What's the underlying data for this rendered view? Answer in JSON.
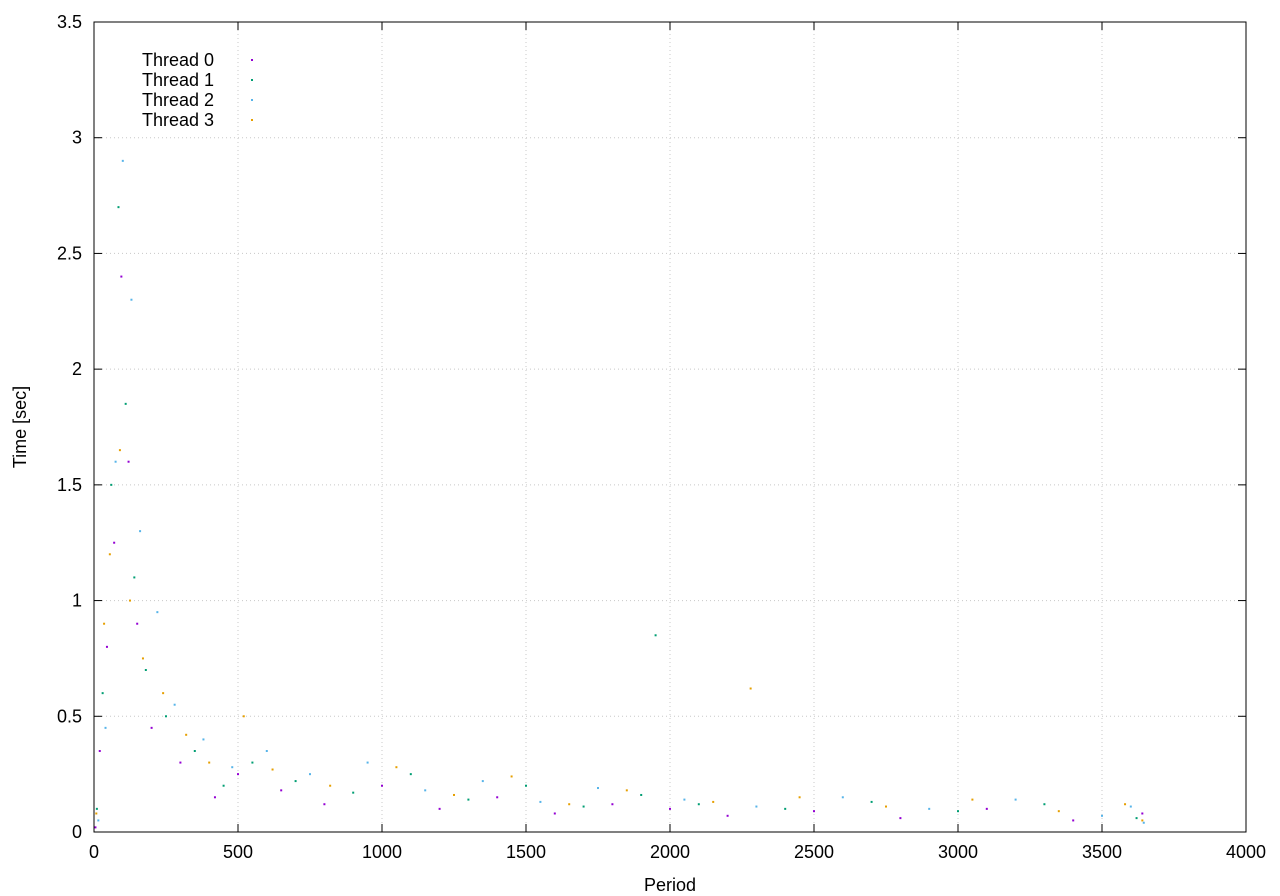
{
  "chart_data": {
    "type": "scatter",
    "title": "",
    "xlabel": "Period",
    "ylabel": "Time [sec]",
    "xlim": [
      0,
      4000
    ],
    "ylim": [
      0,
      3.5
    ],
    "x_ticks": [
      0,
      500,
      1000,
      1500,
      2000,
      2500,
      3000,
      3500,
      4000
    ],
    "y_ticks": [
      0,
      0.5,
      1,
      1.5,
      2,
      2.5,
      3,
      3.5
    ],
    "grid": true,
    "legend_position": "top-left",
    "series": [
      {
        "name": "Thread 0",
        "color": "#9400d3",
        "points": [
          [
            5,
            0.02
          ],
          [
            20,
            0.35
          ],
          [
            45,
            0.8
          ],
          [
            70,
            1.25
          ],
          [
            95,
            2.4
          ],
          [
            120,
            1.6
          ],
          [
            150,
            0.9
          ],
          [
            200,
            0.45
          ],
          [
            300,
            0.3
          ],
          [
            420,
            0.15
          ],
          [
            500,
            0.25
          ],
          [
            650,
            0.18
          ],
          [
            800,
            0.12
          ],
          [
            1000,
            0.2
          ],
          [
            1200,
            0.1
          ],
          [
            1400,
            0.15
          ],
          [
            1600,
            0.08
          ],
          [
            1800,
            0.12
          ],
          [
            2000,
            0.1
          ],
          [
            2200,
            0.07
          ],
          [
            2500,
            0.09
          ],
          [
            2800,
            0.06
          ],
          [
            3100,
            0.1
          ],
          [
            3400,
            0.05
          ],
          [
            3640,
            0.08
          ]
        ]
      },
      {
        "name": "Thread 1",
        "color": "#009e73",
        "points": [
          [
            10,
            0.1
          ],
          [
            30,
            0.6
          ],
          [
            60,
            1.5
          ],
          [
            85,
            2.7
          ],
          [
            110,
            1.85
          ],
          [
            140,
            1.1
          ],
          [
            180,
            0.7
          ],
          [
            250,
            0.5
          ],
          [
            350,
            0.35
          ],
          [
            450,
            0.2
          ],
          [
            550,
            0.3
          ],
          [
            700,
            0.22
          ],
          [
            900,
            0.17
          ],
          [
            1100,
            0.25
          ],
          [
            1300,
            0.14
          ],
          [
            1500,
            0.2
          ],
          [
            1700,
            0.11
          ],
          [
            1900,
            0.16
          ],
          [
            1950,
            0.85
          ],
          [
            2100,
            0.12
          ],
          [
            2400,
            0.1
          ],
          [
            2700,
            0.13
          ],
          [
            3000,
            0.09
          ],
          [
            3300,
            0.12
          ],
          [
            3620,
            0.06
          ]
        ]
      },
      {
        "name": "Thread 2",
        "color": "#56b4e9",
        "points": [
          [
            15,
            0.05
          ],
          [
            40,
            0.45
          ],
          [
            75,
            1.6
          ],
          [
            100,
            2.9
          ],
          [
            130,
            2.3
          ],
          [
            160,
            1.3
          ],
          [
            220,
            0.95
          ],
          [
            280,
            0.55
          ],
          [
            380,
            0.4
          ],
          [
            480,
            0.28
          ],
          [
            600,
            0.35
          ],
          [
            750,
            0.25
          ],
          [
            950,
            0.3
          ],
          [
            1150,
            0.18
          ],
          [
            1350,
            0.22
          ],
          [
            1550,
            0.13
          ],
          [
            1750,
            0.19
          ],
          [
            2050,
            0.14
          ],
          [
            2300,
            0.11
          ],
          [
            2600,
            0.15
          ],
          [
            2900,
            0.1
          ],
          [
            3200,
            0.14
          ],
          [
            3500,
            0.07
          ],
          [
            3600,
            0.11
          ],
          [
            3645,
            0.04
          ]
        ]
      },
      {
        "name": "Thread 3",
        "color": "#e69f00",
        "points": [
          [
            8,
            0.08
          ],
          [
            35,
            0.9
          ],
          [
            55,
            1.2
          ],
          [
            90,
            1.65
          ],
          [
            125,
            1.0
          ],
          [
            170,
            0.75
          ],
          [
            240,
            0.6
          ],
          [
            320,
            0.42
          ],
          [
            400,
            0.3
          ],
          [
            520,
            0.5
          ],
          [
            620,
            0.27
          ],
          [
            820,
            0.2
          ],
          [
            1050,
            0.28
          ],
          [
            1250,
            0.16
          ],
          [
            1450,
            0.24
          ],
          [
            1650,
            0.12
          ],
          [
            1850,
            0.18
          ],
          [
            2150,
            0.13
          ],
          [
            2280,
            0.62
          ],
          [
            2450,
            0.15
          ],
          [
            2750,
            0.11
          ],
          [
            3050,
            0.14
          ],
          [
            3350,
            0.09
          ],
          [
            3580,
            0.12
          ],
          [
            3640,
            0.05
          ]
        ]
      }
    ]
  }
}
